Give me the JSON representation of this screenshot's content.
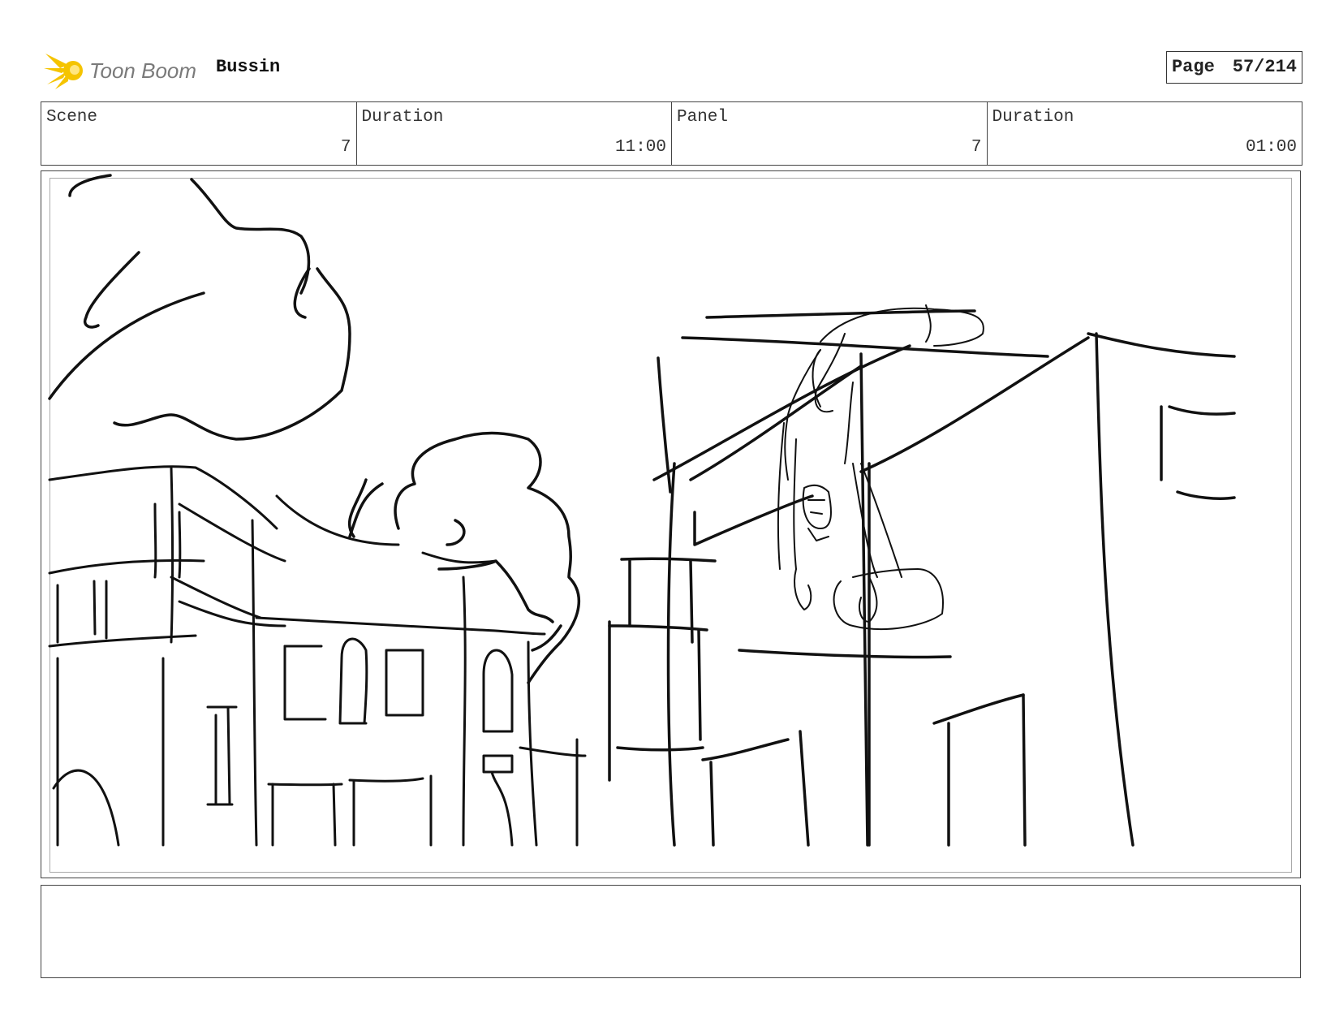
{
  "header": {
    "logo_alt": "Toon Boom",
    "project_title": "Bussin",
    "page_label": "Page",
    "page_number": "57/214"
  },
  "info": {
    "scene_label": "Scene",
    "scene_value": "7",
    "scene_duration_label": "Duration",
    "scene_duration_value": "11:00",
    "panel_label": "Panel",
    "panel_value": "7",
    "panel_duration_label": "Duration",
    "panel_duration_value": "01:00"
  },
  "panel": {
    "image_name": "storyboard-sketch",
    "caption": ""
  },
  "colors": {
    "logo_yellow": "#f5c400",
    "logo_gray": "#7a7a7a",
    "ink": "#111111"
  }
}
